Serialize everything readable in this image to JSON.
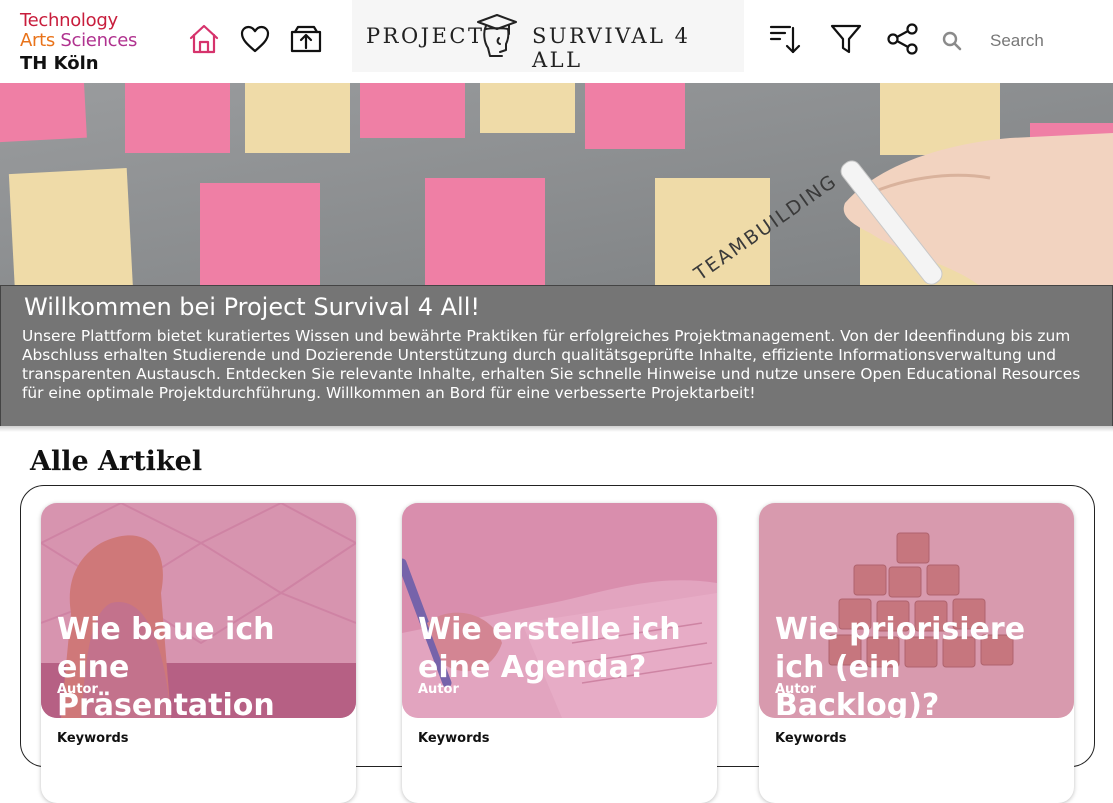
{
  "header": {
    "logo": {
      "line1": "Technology",
      "line2a": "Arts",
      "line2b": "Sciences",
      "line3": "TH Köln"
    },
    "brand": {
      "left": "PROJECT",
      "right": "SURVIVAL 4 ALL"
    },
    "nav": [
      {
        "icon": "home-icon",
        "active": true
      },
      {
        "icon": "heart-icon"
      },
      {
        "icon": "upload-box-icon"
      }
    ],
    "tools": [
      {
        "icon": "sort-icon"
      },
      {
        "icon": "filter-icon"
      },
      {
        "icon": "share-icon"
      }
    ],
    "search": {
      "icon": "search-icon",
      "placeholder": "Search"
    }
  },
  "hero": {
    "image_text": "TEAMBUILDING"
  },
  "welcome": {
    "title": "Willkommen bei Project Survival 4 All!",
    "body": "Unsere Plattform bietet kuratiertes Wissen und bewährte Praktiken für erfolgreiches Projektmanagement. Von der Ideenfindung bis zum Abschluss erhalten Studierende und Dozierende Unterstützung durch qualitätsgeprüfte Inhalte, effiziente Informationsverwaltung und transparenten Austausch. Entdecken Sie relevante Inhalte, erhalten Sie schnelle Hinweise und nutze unsere Open Educational Resources für eine optimale Projektdurchführung. Willkommen an Bord für eine verbesserte Projektarbeit!"
  },
  "section": {
    "title": "Alle Artikel"
  },
  "articles": [
    {
      "title": "Wie baue ich eine Präsentation auf?",
      "author": "Autor",
      "keywords": "Keywords"
    },
    {
      "title": "Wie erstelle ich eine Agenda?",
      "author": "Autor",
      "keywords": "Keywords"
    },
    {
      "title": "Wie priorisiere ich (ein Backlog)?",
      "author": "Autor",
      "keywords": "Keywords"
    }
  ],
  "colors": {
    "accent": "#d6336c",
    "card_overlay": "#d8689a",
    "welcome_bg": "#757575",
    "logo_red": "#c81d3c",
    "logo_orange": "#e9731a",
    "logo_purple": "#b0328f"
  }
}
